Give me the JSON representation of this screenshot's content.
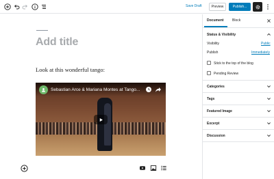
{
  "toolbar": {
    "icons": [
      "add-block-icon",
      "undo-icon",
      "redo-icon",
      "info-icon",
      "outline-icon",
      "gear-icon",
      "more-icon"
    ],
    "save_draft": "Save Draft",
    "preview": "Preview",
    "publish": "Publish..."
  },
  "editor": {
    "title_placeholder": "Add title",
    "paragraph": "Look at this wonderful tango:",
    "video": {
      "title": "Sebastian Arce & Mariana Montes at Tango..."
    }
  },
  "sidebar": {
    "tabs": [
      "Document",
      "Block"
    ],
    "status_panel": {
      "title": "Status & Visibility",
      "visibility_label": "Visibility",
      "visibility_value": "Public",
      "publish_label": "Publish",
      "publish_value": "Immediately",
      "stick_label": "Stick to the top of the blog",
      "pending_label": "Pending Review"
    },
    "panels": [
      "Categories",
      "Tags",
      "Featured Image",
      "Excerpt",
      "Discussion"
    ]
  },
  "colors": {
    "accent": "#007cba",
    "text": "#1e1e1e",
    "border": "#e2e4e7"
  }
}
